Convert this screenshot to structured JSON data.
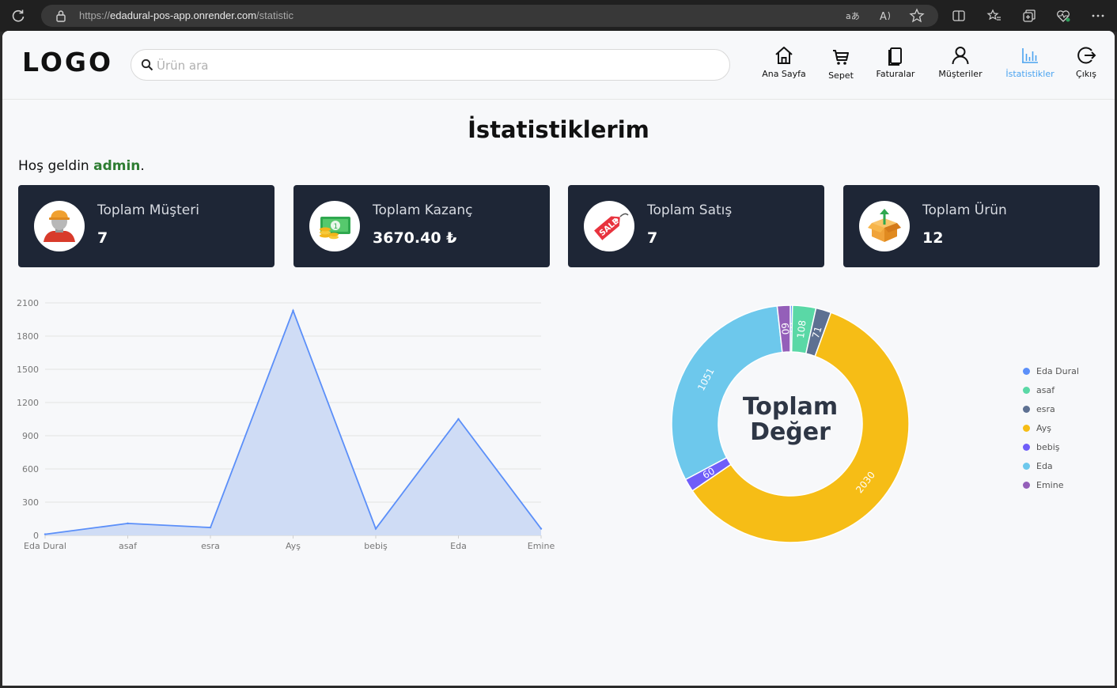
{
  "browser": {
    "url_prefix": "https://",
    "url_host": "edadural-pos-app.onrender.com",
    "url_path": "/statistic"
  },
  "header": {
    "logo": "LOGO",
    "search_placeholder": "Ürün ara",
    "nav": [
      {
        "label": "Ana Sayfa",
        "icon": "home-icon"
      },
      {
        "label": "Sepet",
        "icon": "cart-icon"
      },
      {
        "label": "Faturalar",
        "icon": "invoice-icon"
      },
      {
        "label": "Müşteriler",
        "icon": "user-icon"
      },
      {
        "label": "İstatistikler",
        "icon": "bar-chart-icon",
        "active": true
      },
      {
        "label": "Çıkış",
        "icon": "logout-icon"
      }
    ]
  },
  "main": {
    "title": "İstatistiklerim",
    "welcome_prefix": "Hoş geldin ",
    "welcome_user": "admin",
    "welcome_suffix": "."
  },
  "cards": [
    {
      "label": "Toplam Müşteri",
      "value": "7",
      "icon": "user-avatar-icon"
    },
    {
      "label": "Toplam Kazanç",
      "value": "3670.40 ₺",
      "icon": "money-icon"
    },
    {
      "label": "Toplam Satış",
      "value": "7",
      "icon": "sale-tag-icon"
    },
    {
      "label": "Toplam Ürün",
      "value": "12",
      "icon": "box-icon"
    }
  ],
  "colors": {
    "line": "#5b8ff9",
    "area": "#cfdcf5",
    "card_bg": "#1e2636",
    "accent": "#4aa3f0",
    "username": "#2e7d32"
  },
  "chart_data": [
    {
      "type": "area",
      "categories": [
        "Eda Dural",
        "asaf",
        "esra",
        "Ayş",
        "bebiş",
        "Eda",
        "Emine"
      ],
      "values": [
        10,
        108,
        71,
        2030,
        60,
        1051,
        60
      ],
      "ylim": [
        0,
        2100
      ],
      "yticks": [
        0,
        300,
        600,
        900,
        1200,
        1500,
        1800,
        2100
      ],
      "grid": true
    },
    {
      "type": "pie",
      "center_label_line1": "Toplam",
      "center_label_line2": "Değer",
      "legend_position": "right",
      "slices": [
        {
          "name": "Eda Dural",
          "value": 10,
          "color": "#5b8ff9"
        },
        {
          "name": "asaf",
          "value": 108,
          "color": "#5ad8a6"
        },
        {
          "name": "esra",
          "value": 71,
          "color": "#5d7092"
        },
        {
          "name": "Ayş",
          "value": 2030,
          "color": "#f6bd16"
        },
        {
          "name": "bebiş",
          "value": 60,
          "color": "#6f5ef9"
        },
        {
          "name": "Eda",
          "value": 1051,
          "color": "#6dc8ec"
        },
        {
          "name": "Emine",
          "value": 60,
          "color": "#945fb9"
        }
      ]
    }
  ]
}
